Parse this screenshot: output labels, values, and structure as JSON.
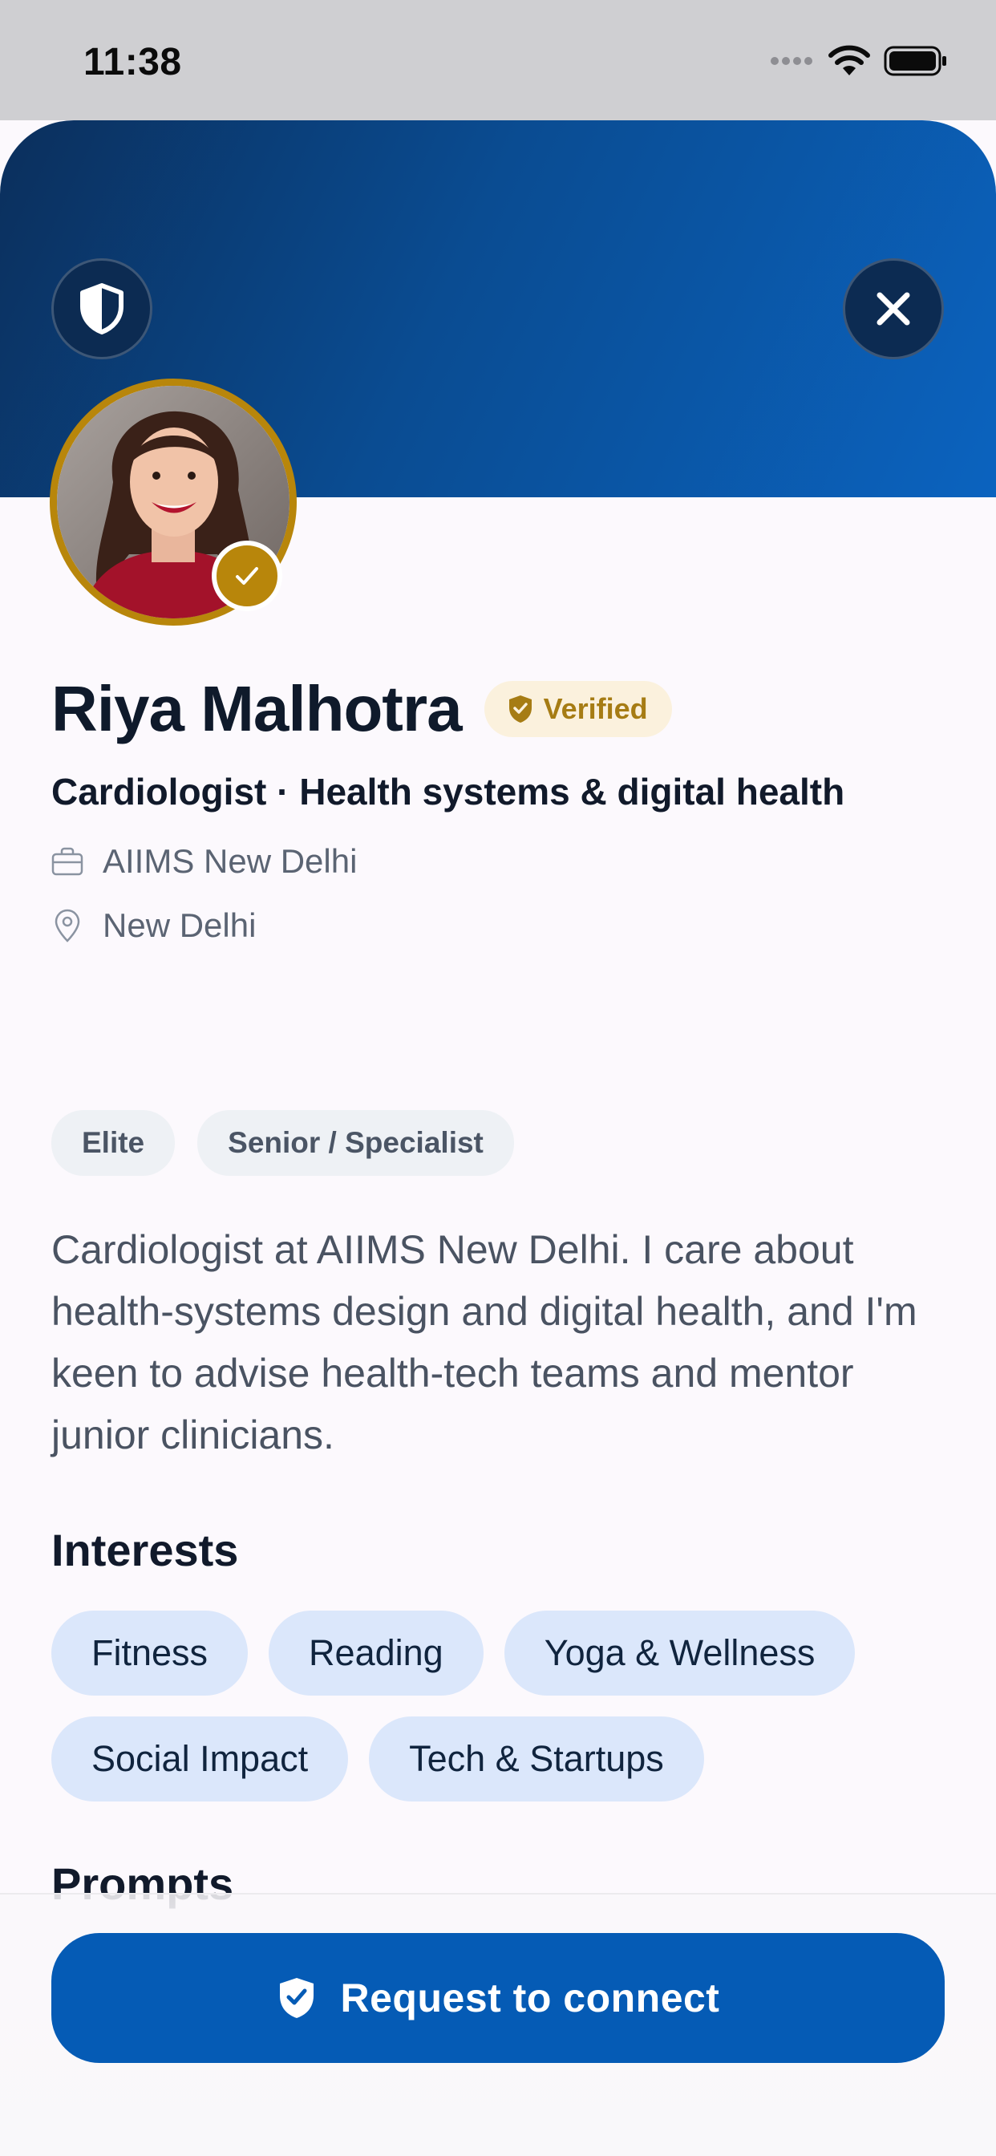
{
  "status_bar": {
    "time": "11:38"
  },
  "profile": {
    "name": "Riya Malhotra",
    "verified_label": "Verified",
    "headline": "Cardiologist · Health systems & digital health",
    "organization": "AIIMS New Delhi",
    "location": "New Delhi",
    "tags": [
      "Elite",
      "Senior / Specialist"
    ],
    "bio": "Cardiologist at AIIMS New Delhi. I care about health-systems design and digital health, and I'm keen to advise health-tech teams and mentor junior clinicians."
  },
  "interests": {
    "title": "Interests",
    "items": [
      "Fitness",
      "Reading",
      "Yoga & Wellness",
      "Social Impact",
      "Tech & Startups"
    ]
  },
  "prompts": {
    "title": "Prompts"
  },
  "cta": {
    "label": "Request to connect"
  },
  "colors": {
    "accent_gold": "#b8860b",
    "primary_blue": "#055bb5",
    "hero_dark": "#0b2f5c",
    "interest_chip": "#dbe7fb"
  },
  "icons": {
    "shield_button": "shield-icon",
    "close_button": "close-icon",
    "organization": "briefcase-icon",
    "location": "map-pin-icon",
    "verified": "shield-check-icon",
    "cta": "shield-check-icon"
  }
}
